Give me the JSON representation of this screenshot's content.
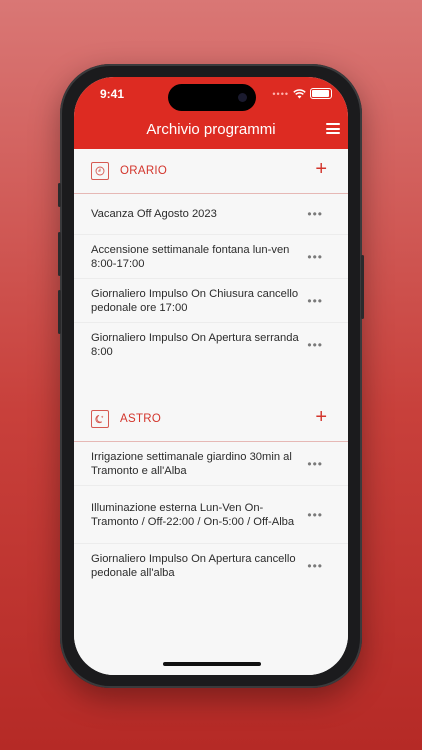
{
  "status": {
    "time": "9:41"
  },
  "header": {
    "title": "Archivio programmi"
  },
  "sections": [
    {
      "label": "ORARIO",
      "icon": "clock-icon",
      "items": [
        {
          "text": "Vacanza Off Agosto 2023"
        },
        {
          "text": "Accensione settimanale fontana lun-ven 8:00-17:00"
        },
        {
          "text": "Giornaliero Impulso On Chiusura cancello pedonale ore 17:00"
        },
        {
          "text": "Giornaliero Impulso On Apertura serranda 8:00"
        }
      ]
    },
    {
      "label": "ASTRO",
      "icon": "moon-star-icon",
      "items": [
        {
          "text": "Irrigazione settimanale giardino 30min al Tramonto e all'Alba"
        },
        {
          "text": "Illuminazione esterna Lun-Ven On-Tramonto / Off-22:00 / On-5:00 / Off-Alba"
        },
        {
          "text": "Giornaliero Impulso On Apertura cancello pedonale all'alba"
        }
      ]
    }
  ],
  "colors": {
    "accent": "#dd2b22",
    "accent_text": "#d3352c",
    "background": "#f7f7f7"
  }
}
